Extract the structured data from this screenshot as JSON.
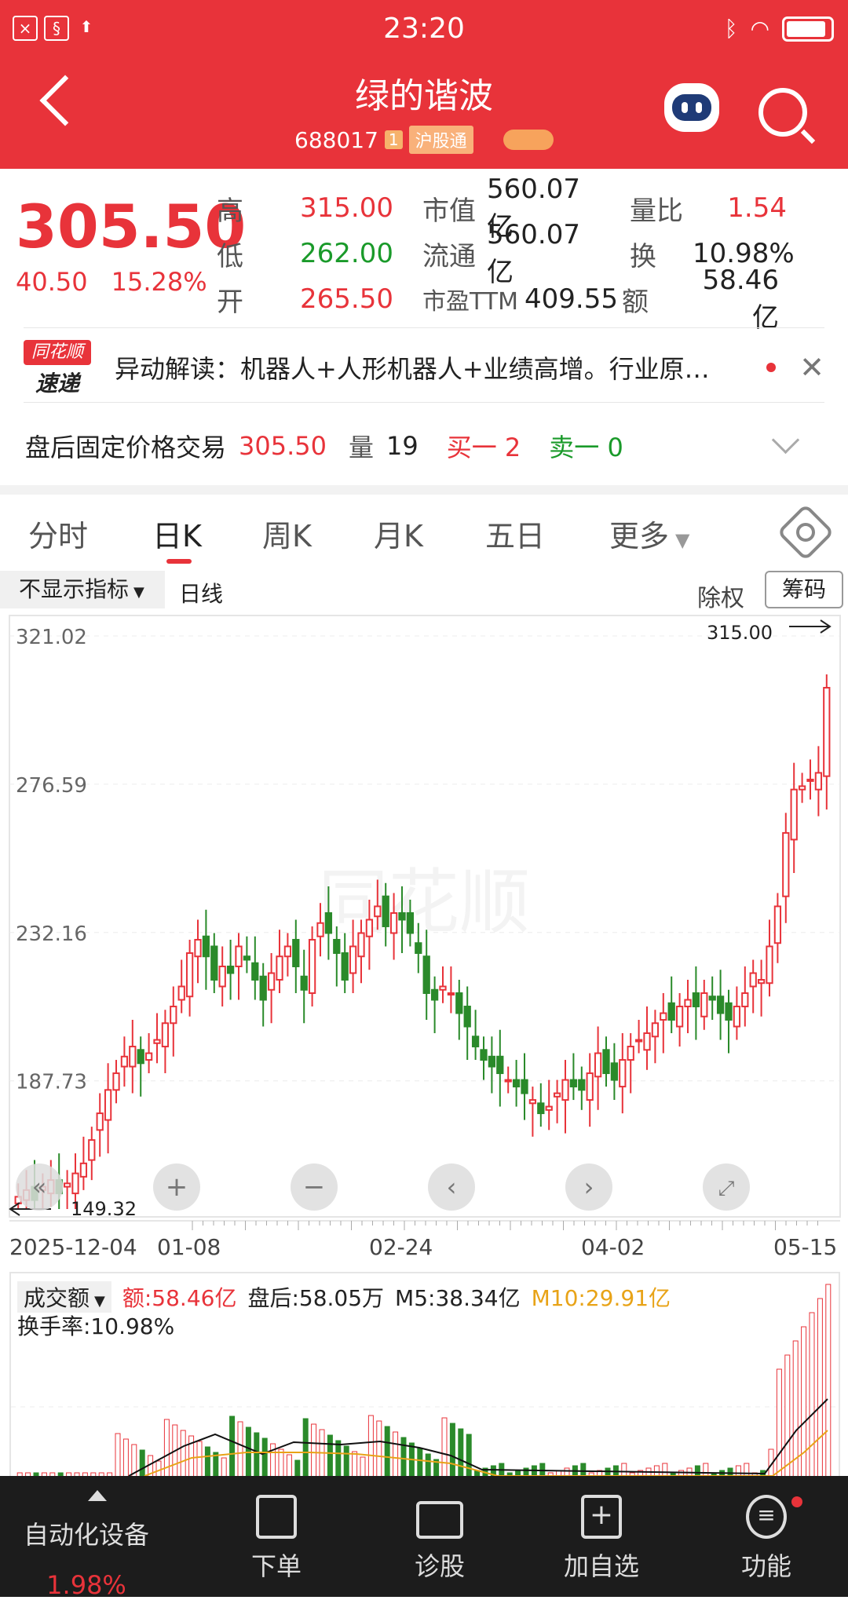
{
  "status": {
    "time": "23:20"
  },
  "header": {
    "name": "绿的谐波",
    "code": "688017",
    "badge_level": "1",
    "badge_market": "沪股通"
  },
  "quote": {
    "price": "305.50",
    "change": "40.50",
    "change_pct": "15.28%",
    "labels": {
      "high": "高",
      "low": "低",
      "open": "开",
      "mcap": "市值",
      "float": "流通",
      "pe": "市盈TTM",
      "vol_ratio": "量比",
      "turnover": "换",
      "amount": "额"
    },
    "high": "315.00",
    "low": "262.00",
    "open": "265.50",
    "mcap": "560.07亿",
    "float": "560.07亿",
    "pe": "409.55",
    "vol_ratio": "1.54",
    "turnover": "10.98%",
    "amount": "58.46亿"
  },
  "notice": {
    "logo_top": "同花顺",
    "logo_bottom": "速递",
    "text": "异动解读：机器人+人形机器人+业绩高增。行业原…"
  },
  "after_hours": {
    "label": "盘后固定价格交易",
    "price": "305.50",
    "vol_label": "量",
    "vol": "19",
    "buy": "买一 2",
    "sell": "卖一 0"
  },
  "tabs": [
    "分时",
    "日K",
    "周K",
    "月K",
    "五日",
    "更多"
  ],
  "indicator": {
    "selector": "不显示指标",
    "period": "日线",
    "adjust": "除权",
    "chips": "筹码"
  },
  "chart_data": {
    "type": "candlestick",
    "y_ticks": [
      "321.02",
      "276.59",
      "232.16",
      "187.73"
    ],
    "ylim": [
      149.32,
      321.02
    ],
    "x_ticks": [
      "2025-12-04",
      "01-08",
      "02-24",
      "04-02",
      "05-15"
    ],
    "max_label": "315.00",
    "min_label": "149.32",
    "watermark": "同花顺",
    "series": [
      {
        "name": "close",
        "values": [
          153,
          155,
          152,
          156,
          158,
          154,
          157,
          160,
          163,
          170,
          178,
          185,
          190,
          195,
          198,
          193,
          196,
          200,
          205,
          210,
          216,
          226,
          230,
          225,
          218,
          222,
          220,
          228,
          224,
          218,
          212,
          220,
          225,
          228,
          222,
          215,
          230,
          235,
          232,
          226,
          218,
          228,
          232,
          236,
          240,
          234,
          238,
          236,
          232,
          226,
          214,
          212,
          216,
          214,
          208,
          204,
          198,
          194,
          192,
          190,
          188,
          186,
          184,
          182,
          178,
          180,
          184,
          188,
          186,
          185,
          190,
          196,
          190,
          188,
          194,
          198,
          200,
          202,
          205,
          208,
          206,
          210,
          212,
          210,
          214,
          212,
          208,
          206,
          210,
          214,
          220,
          218,
          228,
          240,
          262,
          275,
          276,
          278,
          280,
          305.5
        ]
      },
      {
        "name": "成交额",
        "values": []
      }
    ]
  },
  "volume": {
    "selector": "成交额",
    "amount": "额:58.46亿",
    "after": "盘后:58.05万",
    "m5": "M5:38.34亿",
    "m10": "M10:29.91亿",
    "turnover": "换手率:10.98%"
  },
  "nav": {
    "sector_name": "自动化设备",
    "sector_pct": "1.98%",
    "items": [
      "下单",
      "诊股",
      "加自选",
      "功能"
    ]
  }
}
